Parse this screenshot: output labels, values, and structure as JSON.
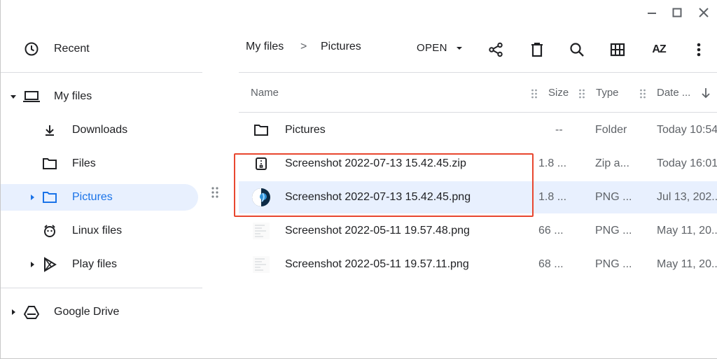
{
  "window_controls": {
    "minimize": "–",
    "maximize": "□",
    "close": "✕"
  },
  "sidebar": {
    "recent": "Recent",
    "my_files": "My files",
    "items": [
      {
        "label": "Downloads",
        "icon": "download-icon"
      },
      {
        "label": "Files",
        "icon": "folder-icon"
      },
      {
        "label": "Pictures",
        "icon": "folder-icon",
        "selected": true
      },
      {
        "label": "Linux files",
        "icon": "linux-icon"
      },
      {
        "label": "Play files",
        "icon": "play-icon"
      }
    ],
    "google_drive": "Google Drive"
  },
  "breadcrumb": {
    "root": "My files",
    "separator": ">",
    "current": "Pictures"
  },
  "toolbar": {
    "open_label": "OPEN",
    "sort_label": "AZ"
  },
  "table": {
    "headers": {
      "name": "Name",
      "size": "Size",
      "type": "Type",
      "date": "Date ..."
    },
    "rows": [
      {
        "name": "Pictures",
        "size": "--",
        "type": "Folder",
        "date": "Today 10:54",
        "icon": "folder-icon"
      },
      {
        "name": "Screenshot 2022-07-13 15.42.45.zip",
        "size": "1.8 ...",
        "type": "Zip a...",
        "date": "Today 16:01",
        "icon": "zip-icon"
      },
      {
        "name": "Screenshot 2022-07-13 15.42.45.png",
        "size": "1.8 ...",
        "type": "PNG ...",
        "date": "Jul 13, 202...",
        "icon": "image-thumbnail",
        "selected": true
      },
      {
        "name": "Screenshot 2022-05-11 19.57.48.png",
        "size": "66 ...",
        "type": "PNG ...",
        "date": "May 11, 20...",
        "icon": "image-thumbnail"
      },
      {
        "name": "Screenshot 2022-05-11 19.57.11.png",
        "size": "68 ...",
        "type": "PNG ...",
        "date": "May 11, 20...",
        "icon": "image-thumbnail"
      }
    ]
  },
  "colors": {
    "accent": "#1a73e8",
    "selection": "#e8f0fe",
    "highlight_box": "#e8472f"
  }
}
